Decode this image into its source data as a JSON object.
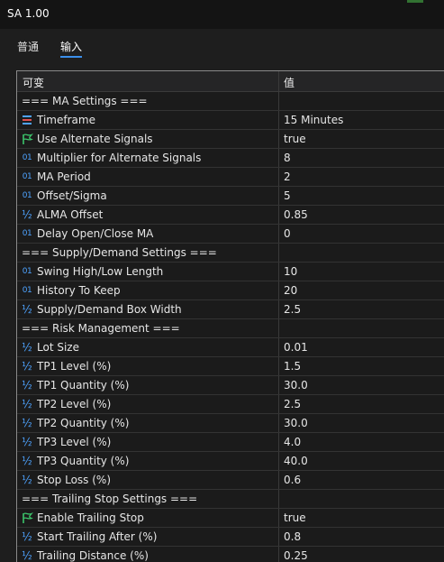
{
  "window": {
    "title": "SA 1.00"
  },
  "tabs": [
    {
      "label": "普通"
    },
    {
      "label": "输入"
    }
  ],
  "table": {
    "col_variable": "可变",
    "col_value": "值",
    "rows": [
      {
        "type": "section",
        "label": "=== MA Settings ===",
        "value": ""
      },
      {
        "type": "time-icon",
        "label": "Timeframe",
        "value": "15 Minutes"
      },
      {
        "type": "bool-icon",
        "label": "Use Alternate Signals",
        "value": "true"
      },
      {
        "type": "int-icon",
        "label": "Multiplier for Alternate Signals",
        "value": "8"
      },
      {
        "type": "int-icon",
        "label": "MA Period",
        "value": "2"
      },
      {
        "type": "int-icon",
        "label": "Offset/Sigma",
        "value": "5"
      },
      {
        "type": "double-icon",
        "label": "ALMA Offset",
        "value": "0.85"
      },
      {
        "type": "int-icon",
        "label": "Delay Open/Close MA",
        "value": "0"
      },
      {
        "type": "section",
        "label": "=== Supply/Demand Settings ===",
        "value": ""
      },
      {
        "type": "int-icon",
        "label": "Swing High/Low Length",
        "value": "10"
      },
      {
        "type": "int-icon",
        "label": "History To Keep",
        "value": "20"
      },
      {
        "type": "double-icon",
        "label": "Supply/Demand Box Width",
        "value": "2.5"
      },
      {
        "type": "section",
        "label": "=== Risk Management ===",
        "value": ""
      },
      {
        "type": "double-icon",
        "label": "Lot Size",
        "value": "0.01"
      },
      {
        "type": "double-icon",
        "label": "TP1 Level (%)",
        "value": "1.5"
      },
      {
        "type": "double-icon",
        "label": "TP1 Quantity (%)",
        "value": "30.0"
      },
      {
        "type": "double-icon",
        "label": "TP2 Level (%)",
        "value": "2.5"
      },
      {
        "type": "double-icon",
        "label": "TP2 Quantity (%)",
        "value": "30.0"
      },
      {
        "type": "double-icon",
        "label": "TP3 Level (%)",
        "value": "4.0"
      },
      {
        "type": "double-icon",
        "label": "TP3 Quantity (%)",
        "value": "40.0"
      },
      {
        "type": "double-icon",
        "label": "Stop Loss (%)",
        "value": "0.6"
      },
      {
        "type": "section",
        "label": "=== Trailing Stop Settings ===",
        "value": ""
      },
      {
        "type": "bool-icon",
        "label": "Enable Trailing Stop",
        "value": "true"
      },
      {
        "type": "double-icon",
        "label": "Start Trailing After (%)",
        "value": "0.8"
      },
      {
        "type": "double-icon",
        "label": "Trailing Distance (%)",
        "value": "0.25"
      }
    ]
  },
  "icons": {
    "int_glyph": "01",
    "double_glyph": "½"
  },
  "colors": {
    "accent": "#3b8eea",
    "icon_blue": "#4ea3ff",
    "flag_green": "#3cc46b"
  }
}
